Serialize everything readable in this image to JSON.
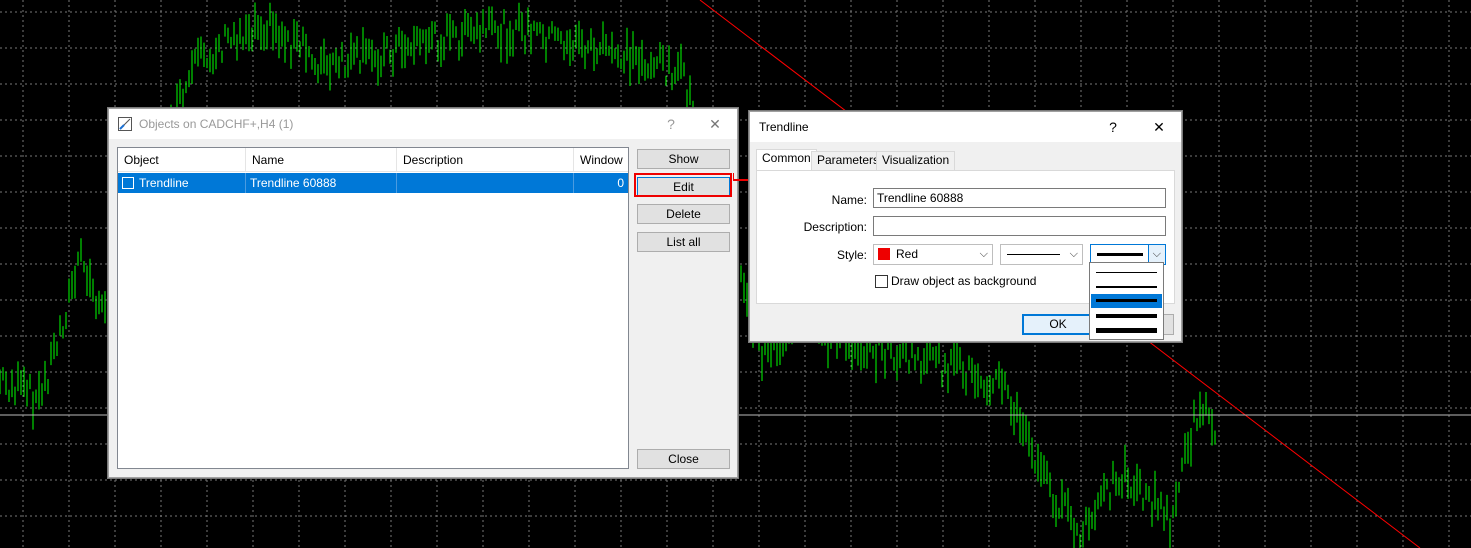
{
  "objects_dialog": {
    "title": "Objects on CADCHF+,H4 (1)",
    "help_label": "?",
    "close_label": "✕",
    "columns": [
      "Object",
      "Name",
      "Description",
      "Window"
    ],
    "rows": [
      {
        "object": "Trendline",
        "name": "Trendline 60888",
        "description": "",
        "window": "0"
      }
    ],
    "buttons": {
      "show": "Show",
      "edit": "Edit",
      "delete": "Delete",
      "list_all": "List all",
      "close": "Close"
    }
  },
  "trendline_dialog": {
    "title": "Trendline",
    "help_label": "?",
    "close_label": "✕",
    "tabs": [
      "Common",
      "Parameters",
      "Visualization"
    ],
    "active_tab": "Common",
    "name_label": "Name:",
    "name_value": "Trendline 60888",
    "description_label": "Description:",
    "description_value": "",
    "style_label": "Style:",
    "color_value": "Red",
    "background_checkbox_label": "Draw object as background",
    "background_checked": false,
    "ok_label": "OK",
    "width_options_count": 5,
    "width_selected_index": 2
  },
  "colors": {
    "chart_background": "#000000",
    "candles": "#00ff00",
    "trendline": "#ff0000",
    "selection": "#0078d7",
    "highlight_box": "#ee0000"
  },
  "icons": [
    "objects-icon",
    "help-icon",
    "close-icon",
    "chevron-down-icon",
    "arrow-icon"
  ]
}
